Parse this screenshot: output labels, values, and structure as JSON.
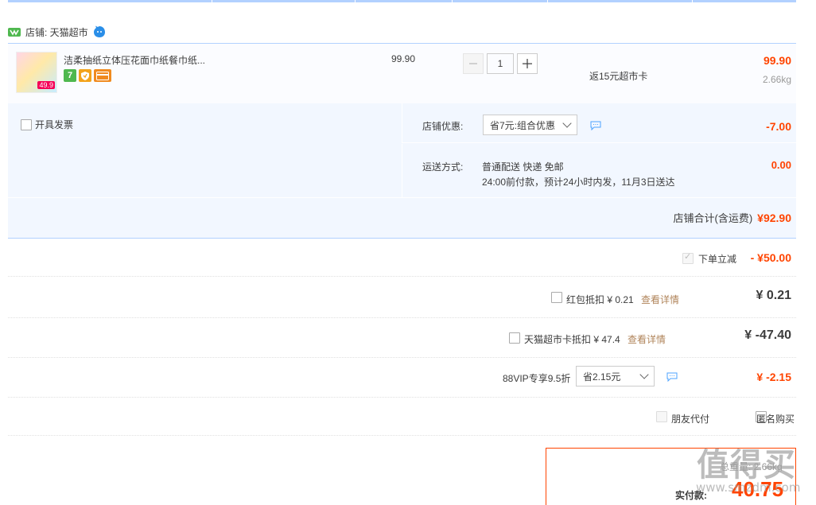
{
  "shop": {
    "label": "店铺: 天猫超市"
  },
  "item": {
    "title": "洁柔抽纸立体压花面巾纸餐巾纸...",
    "thumb_price": "49.9",
    "unit_price": "99.90",
    "quantity": "1",
    "rebate": "返15元超市卡",
    "total": "99.90",
    "weight": "2.66kg",
    "badge_7": "7"
  },
  "invoice": {
    "label": "开具发票"
  },
  "shop_discount": {
    "label": "店铺优惠:",
    "selected": "省7元:组合优惠",
    "amount": "-7.00"
  },
  "shipping": {
    "label": "运送方式:",
    "line1": "普通配送 快递 免邮",
    "line2": "24:00前付款，预计24小时内发，11月3日送达",
    "amount": "0.00"
  },
  "shop_total": {
    "label": "店铺合计(含运费)",
    "amount": "¥92.90"
  },
  "instant_discount": {
    "label": "下单立减",
    "amount": "- ¥50.00"
  },
  "red_packet": {
    "label": "红包抵扣 ¥ 0.21",
    "link": "查看详情",
    "amount": "¥ 0.21"
  },
  "tmall_card": {
    "label": "天猫超市卡抵扣 ¥ 47.4",
    "link": "查看详情",
    "amount": "¥ -47.40"
  },
  "vip88": {
    "label": "88VIP专享9.5折",
    "selected": "省2.15元",
    "amount": "¥ -2.15"
  },
  "friend_pay": {
    "label": "朋友代付"
  },
  "anonymous": {
    "label": "匿名购买"
  },
  "final": {
    "weight_label": "总重量: 2.66kg",
    "pay_label": "实付款:",
    "amount": "40.75"
  },
  "watermark": {
    "big": "值得买",
    "small": "www.smzdm.com"
  },
  "colors": {
    "accent_red": "#ff4400",
    "border_blue": "#b2d1ff",
    "panel_bg": "#f2f7ff",
    "link_brown": "#b0845a"
  }
}
